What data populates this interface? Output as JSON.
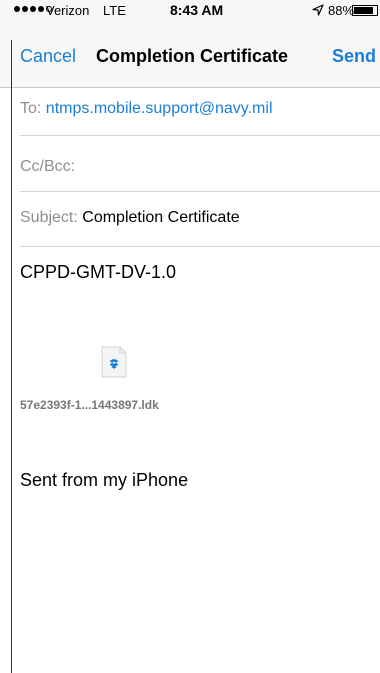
{
  "status_bar": {
    "carrier": "Verizon",
    "network": "LTE",
    "time": "8:43 AM",
    "battery_percent": "88%",
    "battery_level": 0.88,
    "signal_bars_filled": 4,
    "signal_bars_total": 5
  },
  "nav": {
    "cancel_label": "Cancel",
    "title": "Completion Certificate",
    "send_label": "Send"
  },
  "fields": {
    "to_label": "To:",
    "to_value": "ntmps.mobile.support@navy.mil",
    "cc_label": "Cc/Bcc:",
    "subject_label": "Subject:",
    "subject_value": "Completion Certificate"
  },
  "body": {
    "first_line": "CPPD-GMT-DV-1.0",
    "attachment_name": "57e2393f-1...1443897.ldk",
    "attachment_icon": "dropbox-icon",
    "signature": "Sent from my iPhone"
  },
  "colors": {
    "accent": "#1a7ed8",
    "placeholder": "#8e8e93"
  }
}
